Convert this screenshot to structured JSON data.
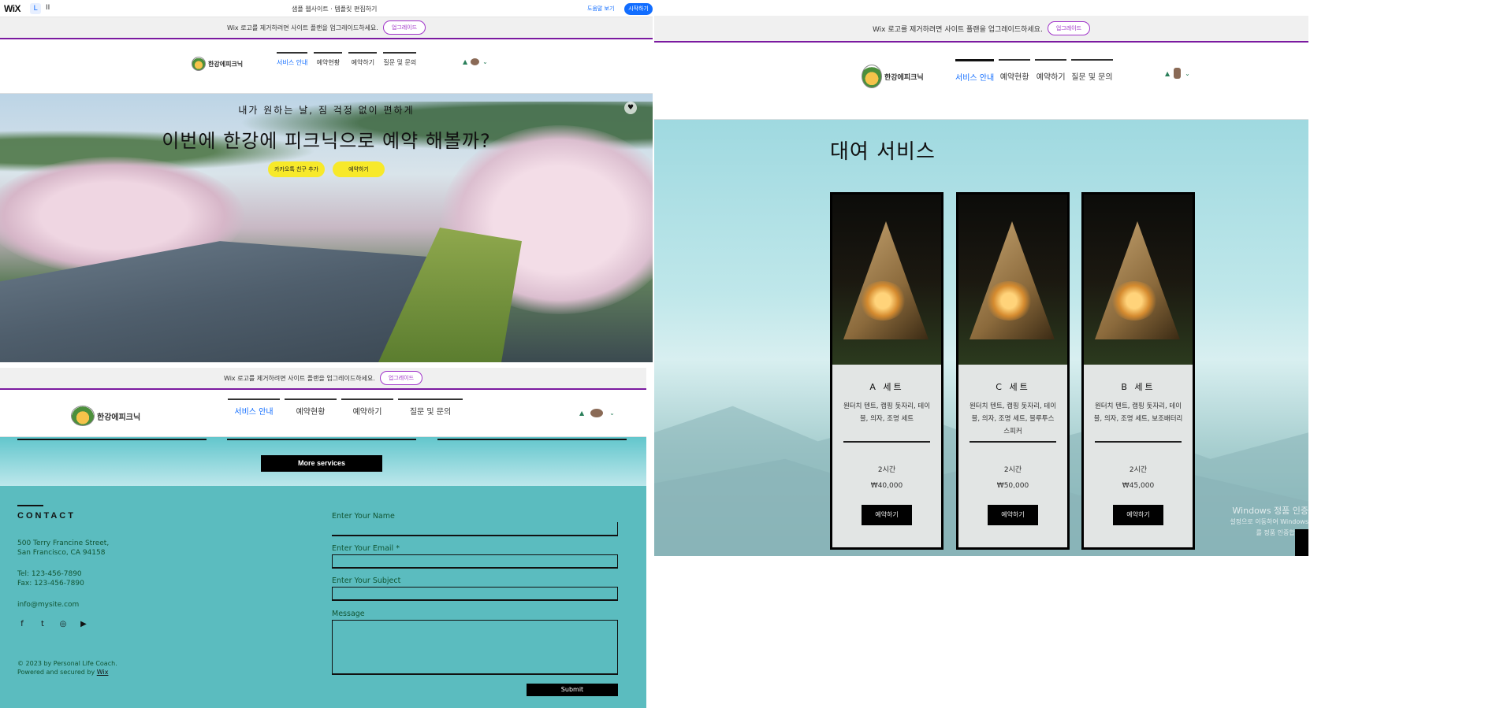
{
  "editor": {
    "logo": "WiX",
    "mode_icon": "L",
    "mode_icon2": "II",
    "title": "샘플 웹사이트 · 템플릿 편집하기",
    "link_label": "도움말 보기",
    "upgrade_label": "시작하기"
  },
  "promo_top": {
    "text": "Wix 로고를 제거하려면 사이트 플랜을 업그레이드하세요.",
    "button": "업그레이드"
  },
  "header": {
    "logo_text": "한강에피크닉",
    "nav": [
      "서비스 안내",
      "예약현황",
      "예약하기",
      "질문 및 문의"
    ]
  },
  "hero": {
    "subtitle": "내가 원하는 날, 짐 걱정 없이 편하게",
    "title": "이번에 한강에 피크닉으로 예약 해볼까?",
    "btn_kakao": "카카오톡 친구 추가",
    "btn_reserve": "예약하기",
    "fav_icon": "♥"
  },
  "promo_mid": {
    "text": "Wix 로고를 제거하려면 사이트 플랜을 업그레이드하세요.",
    "button": "업그레이드"
  },
  "more_services": "More services",
  "contact": {
    "title": "CONTACT",
    "address1": "500 Terry Francine Street,",
    "address2": "San Francisco, CA 94158",
    "tel": "Tel: 123-456-7890",
    "fax": "Fax: 123-456-7890",
    "email": "info@mysite.com",
    "social": [
      "f",
      "t",
      "◎",
      "▶"
    ],
    "form": {
      "name_label": "Enter Your Name",
      "email_label": "Enter Your Email *",
      "subject_label": "Enter Your Subject",
      "message_label": "Message",
      "submit": "Submit"
    },
    "copyright": "© 2023 by Personal Life Coach.",
    "powered": "Powered and secured by",
    "powered_link": "Wix"
  },
  "right_promo": {
    "text": "Wix 로고를 제거하려면 사이트 플랜을 업그레이드하세요.",
    "button": "업그레이드"
  },
  "right_header": {
    "logo_text": "한강에피크닉",
    "nav": [
      "서비스 안내",
      "예약현황",
      "예약하기",
      "질문 및 문의"
    ]
  },
  "rental": {
    "title": "대여 서비스",
    "cards": [
      {
        "name": "A 세트",
        "desc": "원터치 텐트, 캠핑 돗자리, 테이블, 의자, 조명 세트",
        "duration": "2시간",
        "price": "₩40,000",
        "button": "예약하기"
      },
      {
        "name": "C 세트",
        "desc": "원터치 텐트, 캠핑 돗자리, 테이블, 의자, 조명 세트, 블루투스 스피커",
        "duration": "2시간",
        "price": "₩50,000",
        "button": "예약하기"
      },
      {
        "name": "B 세트",
        "desc": "원터치 텐트, 캠핑 돗자리, 테이블, 의자, 조명 세트, 보조배터리",
        "duration": "2시간",
        "price": "₩45,000",
        "button": "예약하기"
      }
    ],
    "watermark1": "Windows 정품 인증",
    "watermark2": "설정으로 이동하여 Windows를 정품 인증합니다."
  },
  "colors": {
    "accent": "#116dff",
    "promo_border": "#7b1aa0",
    "hero_btn": "#f7e92a",
    "contact_bg": "#5bbcbf"
  }
}
